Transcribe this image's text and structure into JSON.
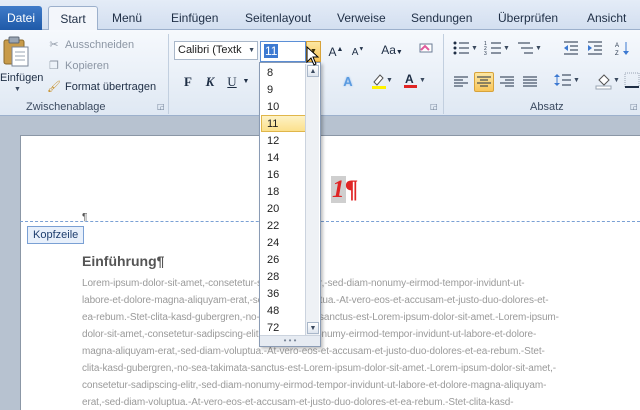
{
  "tabs": {
    "file": "Datei",
    "items": [
      "Start",
      "Menü",
      "Einfügen",
      "Seitenlayout",
      "Verweise",
      "Sendungen",
      "Überprüfen",
      "Ansicht"
    ]
  },
  "clipboard": {
    "paste_label": "Einfügen",
    "cut": "Ausschneiden",
    "copy": "Kopieren",
    "format_painter": "Format übertragen",
    "group_label": "Zwischenablage"
  },
  "font": {
    "font_name": "Calibri (Textk",
    "font_size": "11",
    "size_options": [
      "8",
      "9",
      "10",
      "11",
      "12",
      "14",
      "16",
      "18",
      "20",
      "22",
      "24",
      "26",
      "28",
      "36",
      "48",
      "72"
    ],
    "selected_size": "11",
    "bold": "F",
    "italic": "K",
    "underline": "U",
    "change_case": "Aa"
  },
  "paragraph": {
    "group_label": "Absatz"
  },
  "colors": {
    "accent": "#1f5aa8",
    "highlight": "#fbe08c",
    "font_color": "#e02525",
    "page_number_color": "#e02525"
  },
  "document": {
    "header_tag": "Kopfzeile",
    "header_pilcrow": "¶",
    "page_number": "1",
    "page_number_mark": "¶",
    "heading": "Einführung¶",
    "body_lines": [
      "Lorem-ipsum-dolor-sit-amet,-consetetur-sadipscing-elitr,-sed-diam-nonumy-eirmod-tempor-invidunt-ut-",
      "labore-et-dolore-magna-aliquyam-erat,-sed-diam-voluptua.-At-vero-eos-et-accusam-et-justo-duo-dolores-et-",
      "ea-rebum.-Stet-clita-kasd-gubergren,-no-sea-takimata-sanctus-est-Lorem-ipsum-dolor-sit-amet.-Lorem-ipsum-",
      "dolor-sit-amet,-consetetur-sadipscing-elitr,-sed-diam-nonumy-eirmod-tempor-invidunt-ut-labore-et-dolore-",
      "magna-aliquyam-erat,-sed-diam-voluptua.-At-vero-eos-et-accusam-et-justo-duo-dolores-et-ea-rebum.-Stet-",
      "clita-kasd-gubergren,-no-sea-takimata-sanctus-est-Lorem-ipsum-dolor-sit-amet.-Lorem-ipsum-dolor-sit-amet,-",
      "consetetur-sadipscing-elitr,-sed-diam-nonumy-eirmod-tempor-invidunt-ut-labore-et-dolore-magna-aliquyam-",
      "erat,-sed-diam-voluptua.-At-vero-eos-et-accusam-et-justo-duo-dolores-et-ea-rebum.-Stet-clita-kasd-"
    ]
  }
}
